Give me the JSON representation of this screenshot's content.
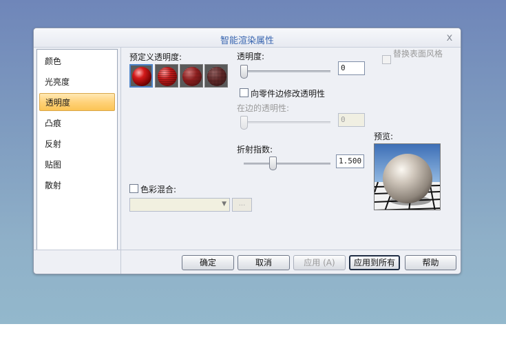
{
  "dialog": {
    "title": "智能渲染属性",
    "close_glyph": "x"
  },
  "nav": {
    "items": [
      {
        "label": "颜色"
      },
      {
        "label": "光亮度"
      },
      {
        "label": "透明度",
        "selected": true
      },
      {
        "label": "凸痕"
      },
      {
        "label": "反射"
      },
      {
        "label": "贴图"
      },
      {
        "label": "散射"
      }
    ]
  },
  "transparency": {
    "predefined_label": "预定义透明度:",
    "label": "透明度:",
    "value": "0",
    "slider_level": 0.0,
    "edge_checkbox_label": "向零件边修改透明性",
    "edge_checked": false,
    "edge_label": "在边的透明性:",
    "edge_value": "0",
    "edge_slider_level": 0.0,
    "refraction_label": "折射指数:",
    "refraction_value": "1.500",
    "refraction_slider_level": 0.33,
    "replace_style_label": "替换表面风格",
    "replace_style_checked": false
  },
  "color_blend": {
    "label": "色彩混合:",
    "checked": false,
    "combo_value": "",
    "ellipsis_label": "..."
  },
  "preview": {
    "label": "预览:"
  },
  "buttons": {
    "ok": "确定",
    "cancel": "取消",
    "apply": "应用 (A)",
    "apply_all": "应用到所有",
    "help": "帮助"
  },
  "colors": {
    "accent": "#3a66b0",
    "selected_bg": "#fbc455",
    "desktop": "#7f9cc0"
  }
}
